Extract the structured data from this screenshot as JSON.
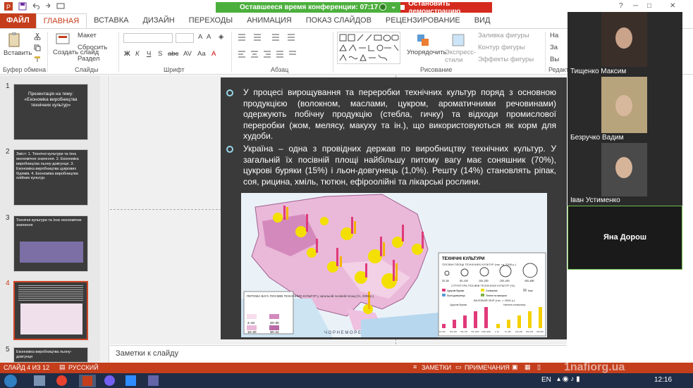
{
  "app": {
    "quick_access": [
      "save-icon",
      "undo-icon",
      "redo-icon",
      "slideshow-icon"
    ],
    "window_controls": [
      "?",
      "─",
      "□",
      "✕"
    ]
  },
  "conference": {
    "time_label": "Оставшееся время конференции: 07:17",
    "stop_label": "Остановить демонстрацию"
  },
  "tabs": [
    "ФАЙЛ",
    "ГЛАВНАЯ",
    "ВСТАВКА",
    "ДИЗАЙН",
    "ПЕРЕХОДЫ",
    "АНИМАЦИЯ",
    "ПОКАЗ СЛАЙДОВ",
    "РЕЦЕНЗИРОВАНИЕ",
    "ВИД"
  ],
  "ribbon": {
    "paste": "Вставить",
    "create_slide": "Создать слайд",
    "layout": "Макет",
    "reset": "Сбросить",
    "section": "Раздел",
    "group_clipboard": "Буфер обмена",
    "group_slides": "Слайды",
    "group_font": "Шрифт",
    "group_paragraph": "Абзац",
    "group_drawing": "Рисование",
    "group_edit": "Редакт",
    "arrange": "Упорядочить",
    "express_styles": "Экспресс-стили",
    "fill": "Заливка фигуры",
    "outline": "Контур фигуры",
    "effects": "Эффекты фигуры",
    "find": "На",
    "replace": "За",
    "select": "Вы",
    "font_buttons": [
      "Ж",
      "К",
      "Ч",
      "S",
      "abc",
      "AV",
      "Aa",
      "A"
    ]
  },
  "thumbnails": [
    {
      "num": "1",
      "text": "Презентація на тему: «Економіка виробництва технічних культур»"
    },
    {
      "num": "2",
      "text": "Зміст: 1. Технічні культури та їхнє економічне значення. 2. Економіка виробництва льону-довгунця. 3. Економіка виробництва цукрових буряків. 4. Економіка виробництва олійних культур."
    },
    {
      "num": "3",
      "text": "Технічні культури та їхнє економічне значення"
    },
    {
      "num": "4",
      "text": ""
    },
    {
      "num": "5",
      "text": "Економіка виробництва льону-довгунця"
    }
  ],
  "slide": {
    "bullet1": "У процесі вирощування та переробки технічних культур поряд з основною продукцією (волокном, маслами, цукром, ароматичними речовинами) одержують побічну продукцію (стебла, гичку) та відходи промислової переробки (жом, мелясу, макуху та ін.), що використовуються як корм для худоби.",
    "bullet2": "Україна – одна з провідних держав по виробництву технічних культур. У загальній їх посівній площі найбільшу питому вагу має соняшник (70%), цукрові буряки (15%) і льон-довгунець (1,0%). Решту (14%) становлять ріпак, соя, рицина, хміль, тютюн, ефіроолійні та лікарські рослини.",
    "map_legend_title": "ТЕХНІЧНІ КУЛЬТУРИ",
    "map_legend_sub": "ПОСІВНІ ПЛОЩІ ТЕХНІЧНИХ КУЛЬТУР (тис. га, 2006 р.)",
    "map_structure": "СТРУКТУРА ПОСІВІВ ТЕХНІЧНИХ КУЛЬТУР (%)",
    "map_crops": [
      "Цукрові буряки",
      "Соняшник",
      "Льон-довгунець",
      "Тютюн та махорка",
      "Інші"
    ],
    "map_harvest": "ВАЛОВИЙ ЗБІР (тис. т, 2006 р.)",
    "map_harvest_a": "Цукрові буряки",
    "map_harvest_b": "Насіння соняшнику",
    "map_left_legend": "ПИТОМА ВАГА ПОСІВІВ ТЕХНІЧНИХ КУЛЬТУР у загальній посівній площі (%, 2006 р.)",
    "map_left_ranges": [
      "2–10",
      "20–30",
      "10–20",
      "30–41"
    ],
    "sea_label": "Ч О Р Н Е   М О Р Е",
    "scale_labels": [
      "20–50",
      "50–100",
      "100–200",
      "200–400",
      "400–650"
    ],
    "harvest_labels": [
      "10–200",
      "200–400",
      "400–700",
      "700–1000",
      "1000–2000",
      "1–10",
      "10–150",
      "150–300",
      "300–400",
      "400–801"
    ]
  },
  "notes_placeholder": "Заметки к слайду",
  "status": {
    "slide_info": "СЛАЙД 4 ИЗ 12",
    "language": "РУССКИЙ",
    "notes": "ЗАМЕТКИ",
    "comments": "ПРИМЕЧАНИЯ"
  },
  "participants": [
    {
      "name": "Тищенко Максим"
    },
    {
      "name": "Безручко Вадим"
    },
    {
      "name": "Іван Устименко"
    },
    {
      "name": "Яна Дорош"
    }
  ],
  "taskbar": {
    "lang": "EN",
    "time": "12:16"
  },
  "watermark": "1nafiorg.ua",
  "colors": {
    "accent": "#c43e1c",
    "conference": "#4caf3d",
    "stop": "#d52b1e",
    "slide_bg": "#3a3a3a",
    "bullet": "#9ad5e8"
  }
}
